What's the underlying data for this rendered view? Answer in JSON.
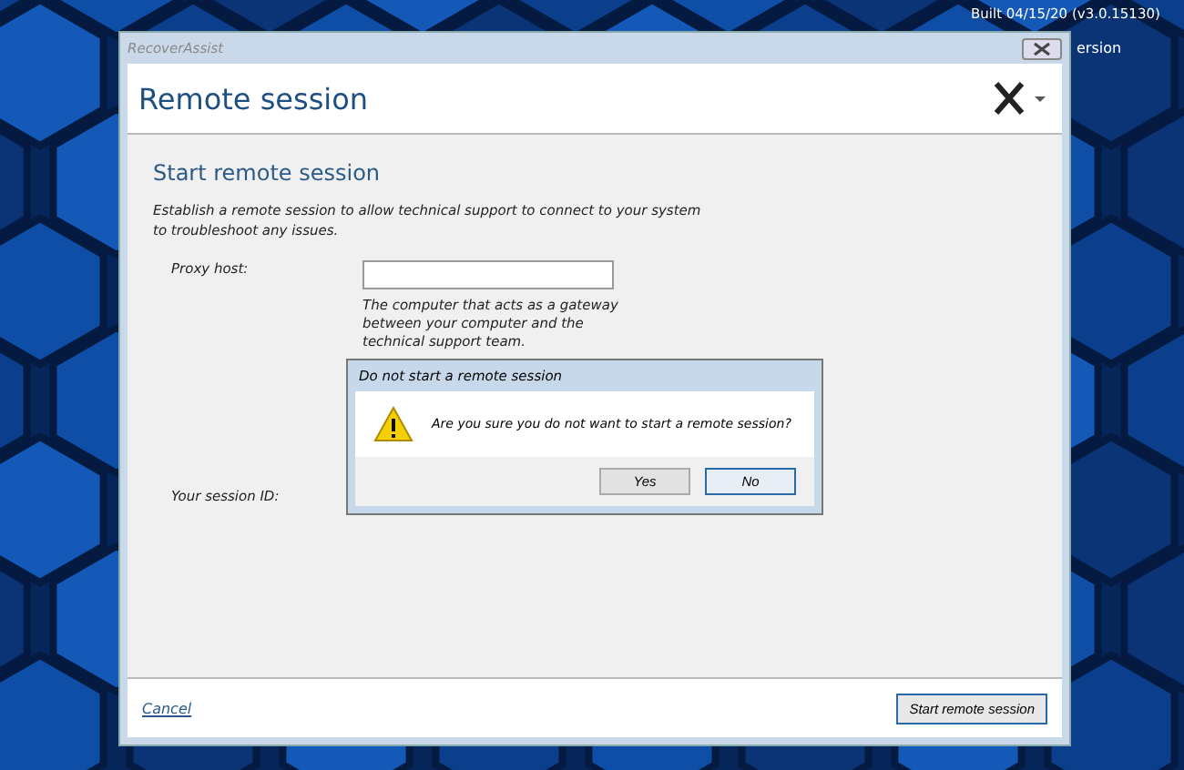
{
  "desktop": {
    "build_info": "Built 04/15/20 (v3.0.15130)",
    "hidden_fragment": "ersion"
  },
  "window": {
    "title": "RecoverAssist",
    "heading": "Remote session"
  },
  "section": {
    "title": "Start remote session",
    "description": "Establish a remote session to allow technical support to connect to your system to troubleshoot any issues.",
    "fields": [
      {
        "label": "Proxy host:",
        "help": "The computer that acts as a gateway between your computer and the technical support team."
      },
      {
        "label": "Your session ID:"
      }
    ]
  },
  "dialog": {
    "title": "Do not start a remote session",
    "message": "Are you sure you do not want to start a remote session?",
    "buttons": [
      {
        "label": "Yes",
        "selected": false
      },
      {
        "label": "No",
        "selected": true
      }
    ]
  },
  "footer": {
    "cancel": "Cancel",
    "primary": "Start remote session"
  }
}
